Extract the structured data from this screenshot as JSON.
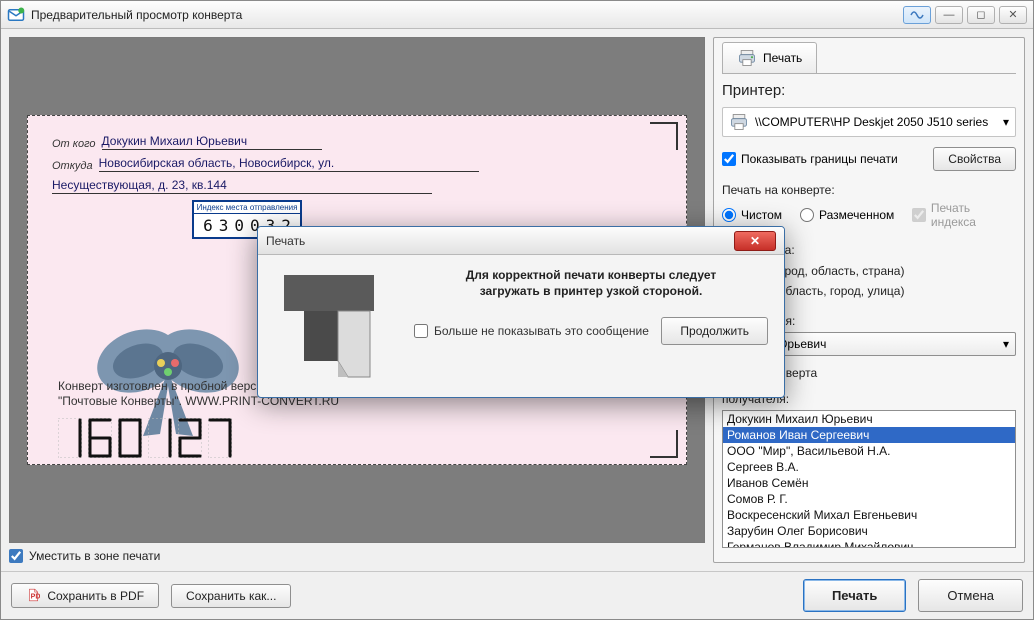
{
  "window": {
    "title": "Предварительный просмотр конверта"
  },
  "envelope": {
    "from_label": "От кого",
    "from_value": "Докукин Михаил Юрьевич",
    "addr_label": "Откуда",
    "addr_value": "Новосибирская область, Новосибирск, ул.",
    "addr_value2": "Несуществующая, д. 23, кв.144",
    "index_caption": "Индекс места отправления",
    "index_value": "630032",
    "footer_line1": "Конверт изготовлен в пробной версии программы",
    "footer_line2": "\"Почтовые Конверты\". WWW.PRINT-CONVERT.RU",
    "big_index_digits": [
      "1",
      "6",
      "0",
      "1",
      "2",
      "7"
    ]
  },
  "fit_label": "Уместить в зоне печати",
  "panel": {
    "tab_label": "Печать",
    "printer_section": "Принтер:",
    "printer_name": "\\\\COMPUTER\\HP Deskjet 2050 J510 series",
    "show_bounds": "Показывать границы печати",
    "properties_btn": "Свойства",
    "print_on_label": "Печать на конверте:",
    "radio_blank": "Чистом",
    "radio_marked": "Размеченном",
    "print_index": "Печать индекса",
    "addr_header": "вода адреса:",
    "addr_opt1": "(улица, город, область, страна)",
    "addr_opt2": "(страна, область, город, улица)",
    "sender_header": "отправителя:",
    "sender_value": "Михаил Юрьевич",
    "blank_env": "чистого конверта",
    "recipient_header": "получателя:",
    "recipients": [
      "Докукин Михаил Юрьевич",
      "Романов Иван Сергеевич",
      "ООО \"Мир\", Васильевой Н.А.",
      "Сергеев В.А.",
      "Иванов Семён",
      "Сомов Р. Г.",
      "Воскресенский Михал Евгеньевич",
      "Зарубин Олег Борисович",
      "Германов Владимир Михайлович"
    ],
    "recipient_selected_index": 1
  },
  "footer": {
    "save_pdf": "Сохранить в PDF",
    "save_as": "Сохранить как...",
    "print": "Печать",
    "cancel": "Отмена"
  },
  "modal": {
    "title": "Печать",
    "message_l1": "Для корректной печати конверты следует",
    "message_l2": "загружать в принтер узкой стороной.",
    "dont_show": "Больше не показывать это сообщение",
    "continue": "Продолжить"
  }
}
